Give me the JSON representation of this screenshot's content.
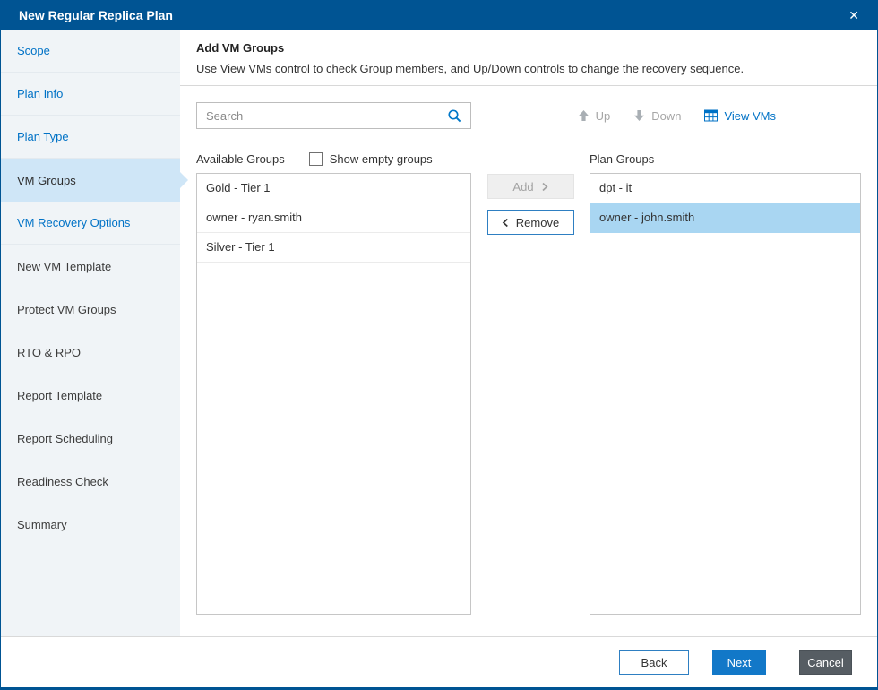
{
  "colors": {
    "titlebar": "#005493",
    "accent": "#0072c6",
    "selected_row": "#a9d6f2",
    "sidebar_active_bg": "#cfe6f7",
    "next_button": "#1278c8",
    "cancel_button": "#565d63"
  },
  "titlebar": {
    "title": "New Regular Replica Plan",
    "close_label": "✕"
  },
  "sidebar": {
    "items": [
      {
        "label": "Scope",
        "state": "link"
      },
      {
        "label": "Plan Info",
        "state": "link"
      },
      {
        "label": "Plan Type",
        "state": "link"
      },
      {
        "label": "VM Groups",
        "state": "active"
      },
      {
        "label": "VM Recovery Options",
        "state": "link"
      },
      {
        "label": "New VM Template",
        "state": "normal"
      },
      {
        "label": "Protect VM Groups",
        "state": "normal"
      },
      {
        "label": "RTO & RPO",
        "state": "normal"
      },
      {
        "label": "Report Template",
        "state": "normal"
      },
      {
        "label": "Report Scheduling",
        "state": "normal"
      },
      {
        "label": "Readiness Check",
        "state": "normal"
      },
      {
        "label": "Summary",
        "state": "normal"
      }
    ]
  },
  "header": {
    "title": "Add VM Groups",
    "description": "Use View VMs control to check Group members, and Up/Down controls to change the recovery sequence."
  },
  "toolbar": {
    "search_placeholder": "Search",
    "up_label": "Up",
    "down_label": "Down",
    "view_vms_label": "View VMs"
  },
  "icons": {
    "close": "x-mark",
    "search": "magnifier",
    "up": "arrow-up",
    "down": "arrow-down",
    "view_vms": "table",
    "add": "chevron-right",
    "remove": "chevron-left"
  },
  "available": {
    "label": "Available Groups",
    "show_empty_label": "Show empty groups",
    "show_empty_checked": false,
    "items": [
      {
        "label": "Gold - Tier 1"
      },
      {
        "label": "owner - ryan.smith"
      },
      {
        "label": "Silver - Tier 1"
      }
    ]
  },
  "transfer": {
    "add_label": "Add",
    "remove_label": "Remove"
  },
  "plan": {
    "label": "Plan Groups",
    "items": [
      {
        "label": "dpt - it",
        "selected": false
      },
      {
        "label": "owner - john.smith",
        "selected": true
      }
    ]
  },
  "footer": {
    "back_label": "Back",
    "next_label": "Next",
    "cancel_label": "Cancel"
  }
}
